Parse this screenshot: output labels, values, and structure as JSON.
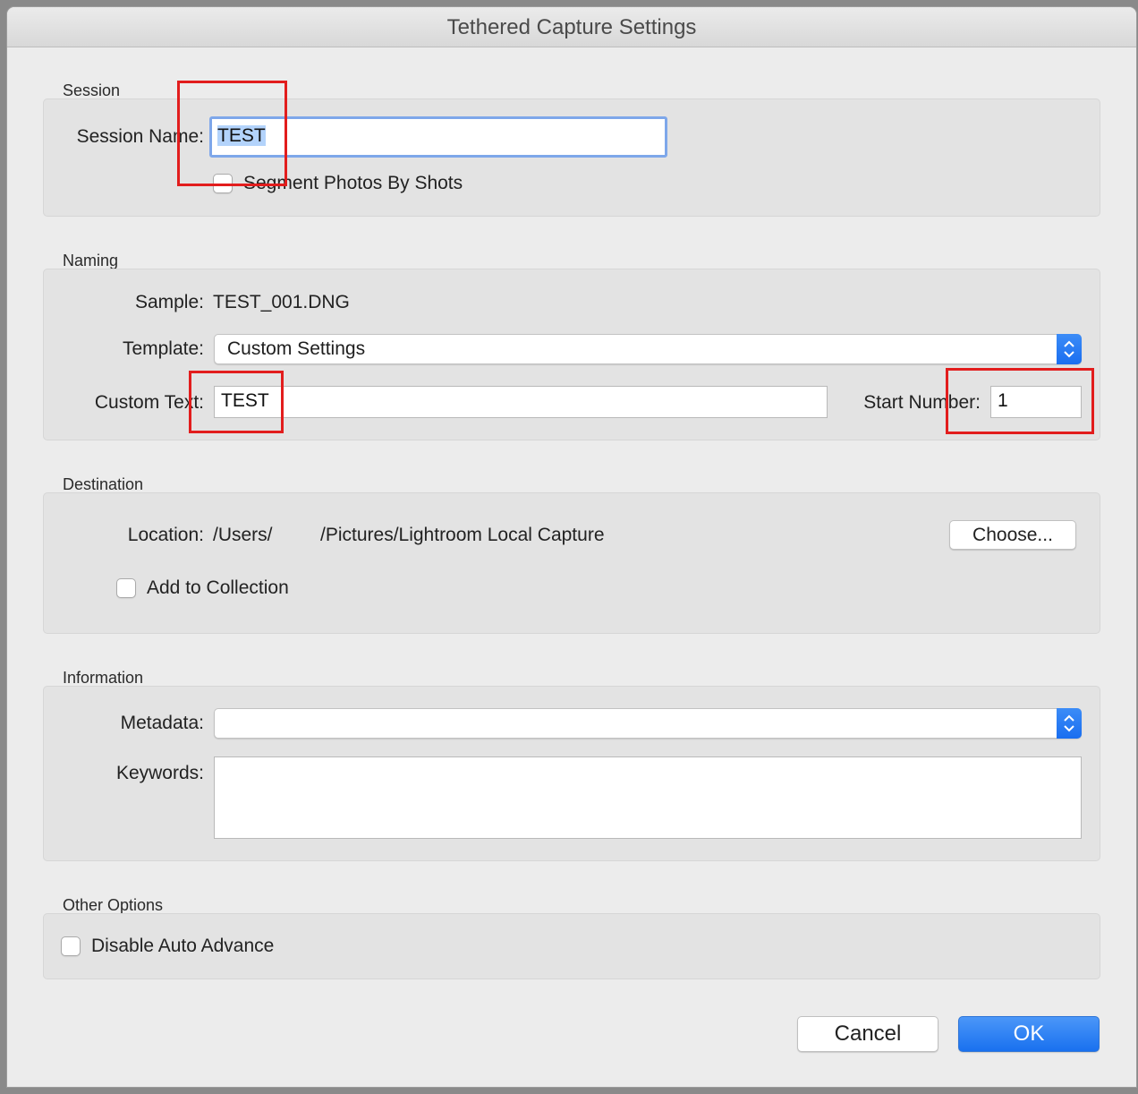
{
  "window": {
    "title": "Tethered Capture Settings"
  },
  "session": {
    "section_title": "Session",
    "name_label": "Session Name:",
    "name_value": "TEST",
    "segment_label": "Segment Photos By Shots"
  },
  "naming": {
    "section_title": "Naming",
    "sample_label": "Sample:",
    "sample_value": "TEST_001.DNG",
    "template_label": "Template:",
    "template_value": "Custom Settings",
    "custom_text_label": "Custom Text:",
    "custom_text_value": "TEST",
    "start_number_label": "Start Number:",
    "start_number_value": "1"
  },
  "destination": {
    "section_title": "Destination",
    "location_label": "Location:",
    "location_value_part1": "/Users/",
    "location_value_part2": "/Pictures/Lightroom Local Capture",
    "choose_label": "Choose...",
    "add_collection_label": "Add to Collection"
  },
  "information": {
    "section_title": "Information",
    "metadata_label": "Metadata:",
    "metadata_value": "",
    "keywords_label": "Keywords:",
    "keywords_value": ""
  },
  "other": {
    "section_title": "Other Options",
    "disable_auto_advance_label": "Disable Auto Advance"
  },
  "footer": {
    "cancel_label": "Cancel",
    "ok_label": "OK"
  },
  "colors": {
    "accent": "#1a6ef0",
    "annotation": "#e21d1d",
    "selection": "#b3d3fb"
  }
}
